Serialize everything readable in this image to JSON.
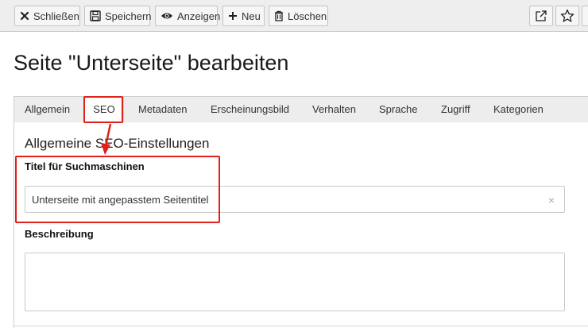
{
  "toolbar": {
    "close_label": "Schließen",
    "save_label": "Speichern",
    "view_label": "Anzeigen",
    "new_label": "Neu",
    "delete_label": "Löschen"
  },
  "page": {
    "title": "Seite \"Unterseite\" bearbeiten"
  },
  "tabs": [
    {
      "label": "Allgemein"
    },
    {
      "label": "SEO",
      "active": true
    },
    {
      "label": "Metadaten"
    },
    {
      "label": "Erscheinungsbild"
    },
    {
      "label": "Verhalten"
    },
    {
      "label": "Sprache"
    },
    {
      "label": "Zugriff"
    },
    {
      "label": "Kategorien"
    }
  ],
  "form": {
    "section_heading": "Allgemeine SEO-Einstellungen",
    "seo_title": {
      "label": "Titel für Suchmaschinen",
      "value": "Unterseite mit angepasstem Seitentitel",
      "clear_glyph": "×"
    },
    "description": {
      "label": "Beschreibung",
      "value": ""
    }
  },
  "colors": {
    "annotation": "#e0201b",
    "toolbar_bg": "#eeeeee",
    "tabbar_bg": "#ededed"
  }
}
